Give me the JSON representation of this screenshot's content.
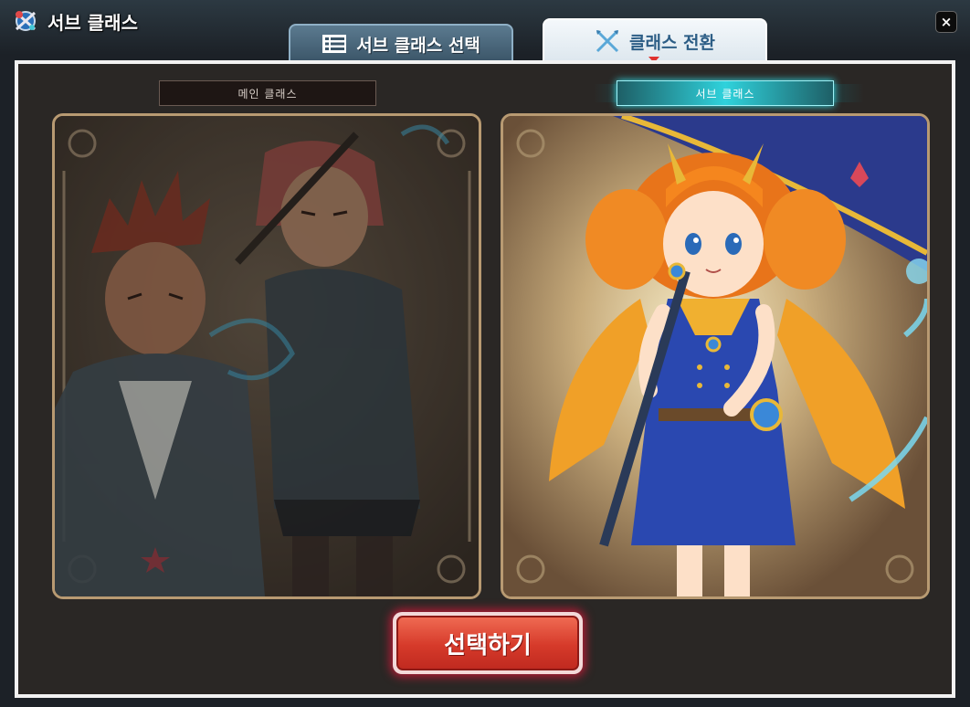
{
  "window": {
    "title": "서브 클래스",
    "close_label": "×"
  },
  "tabs": [
    {
      "label": "서브 클래스 선택",
      "icon": "list-icon",
      "active": false
    },
    {
      "label": "클래스 전환",
      "icon": "crossed-swords-icon",
      "active": true
    }
  ],
  "panel": {
    "main_class_label": "메인 클래스",
    "sub_class_label": "서브 클래스",
    "select_button_label": "선택하기"
  },
  "colors": {
    "tab_active_text": "#2d5e86",
    "sub_label_glow": "#2fd2dc",
    "button_red": "#d63a2a",
    "card_border": "#b89a72"
  }
}
